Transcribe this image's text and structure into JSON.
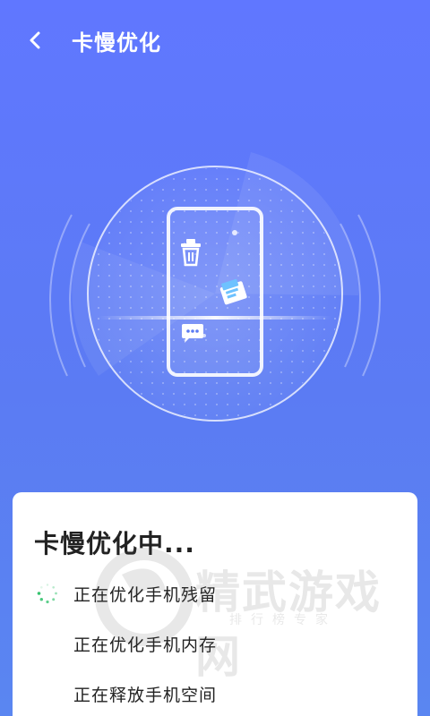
{
  "header": {
    "title": "卡慢优化",
    "back_icon": "back-arrow-icon"
  },
  "scan": {
    "icons": [
      "phone-outline-icon",
      "trash-bin-icon",
      "folder-icon",
      "chat-bubble-icon"
    ]
  },
  "card": {
    "title": "卡慢优化中...",
    "tasks": [
      {
        "label": "正在优化手机残留",
        "status": "loading"
      },
      {
        "label": "正在优化手机内存",
        "status": "pending"
      },
      {
        "label": "正在释放手机空间",
        "status": "pending"
      }
    ]
  },
  "watermark": {
    "main": "精武游戏网",
    "sub": "排行榜专家"
  },
  "colors": {
    "background": "#5b7bf3",
    "card": "#ffffff",
    "spinner": "#36c36f"
  }
}
